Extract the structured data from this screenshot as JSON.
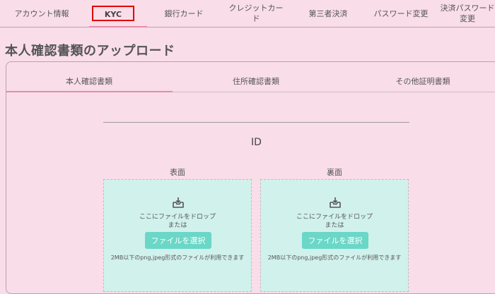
{
  "nav": {
    "items": [
      {
        "label": "アカウント情報"
      },
      {
        "label": "KYC"
      },
      {
        "label": "銀行カード"
      },
      {
        "label": "クレジットカード"
      },
      {
        "label": "第三者決済"
      },
      {
        "label": "パスワード変更"
      },
      {
        "label": "決済パスワード変更"
      }
    ],
    "active_index": 1,
    "highlight_color": "#e10000"
  },
  "page_title": "本人確認書類のアップロード",
  "tabs": [
    {
      "label": "本人確認書類"
    },
    {
      "label": "住所確認書類"
    },
    {
      "label": "その他証明書類"
    }
  ],
  "active_tab": 0,
  "section_title": "ID",
  "upload": {
    "front_label": "表面",
    "back_label": "裏面",
    "drop_text": "ここにファイルをドロップ",
    "or_text": "または",
    "button_label": "ファイルを選択",
    "note": "2MB以下のpng,jpeg形式のファイルが利用できます",
    "icon": "inbox-upload-icon"
  },
  "colors": {
    "background": "#f9dde9",
    "accent": "#e88aa8",
    "dropzone": "#d1f1ec",
    "button": "#6ad7c7"
  }
}
